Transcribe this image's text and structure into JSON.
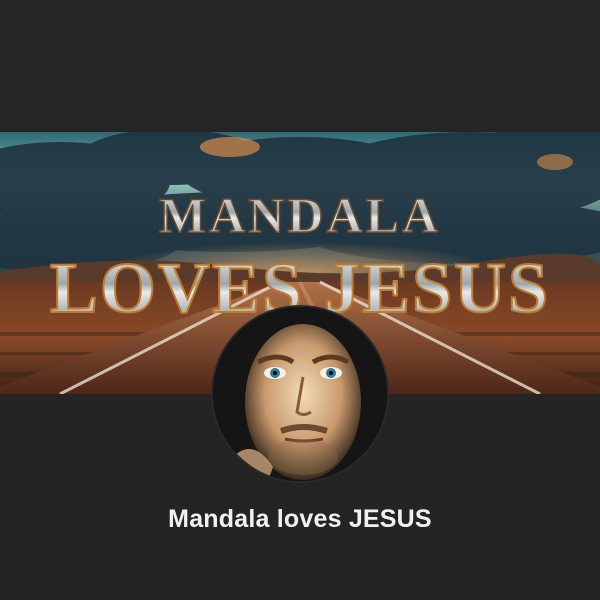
{
  "banner": {
    "line1": "MANDALA",
    "line2": "LOVES JESUS"
  },
  "channel": {
    "name": "Mandala loves JESUS"
  },
  "colors": {
    "background": "#242424",
    "sky_top": "#3c7f86",
    "sky_mid": "#8fb9b3",
    "road": "#6a3620",
    "title_metal": "#d6d8da",
    "title_outline": "#c07a2c"
  },
  "icons": {
    "avatar": "profile-photo-icon"
  }
}
